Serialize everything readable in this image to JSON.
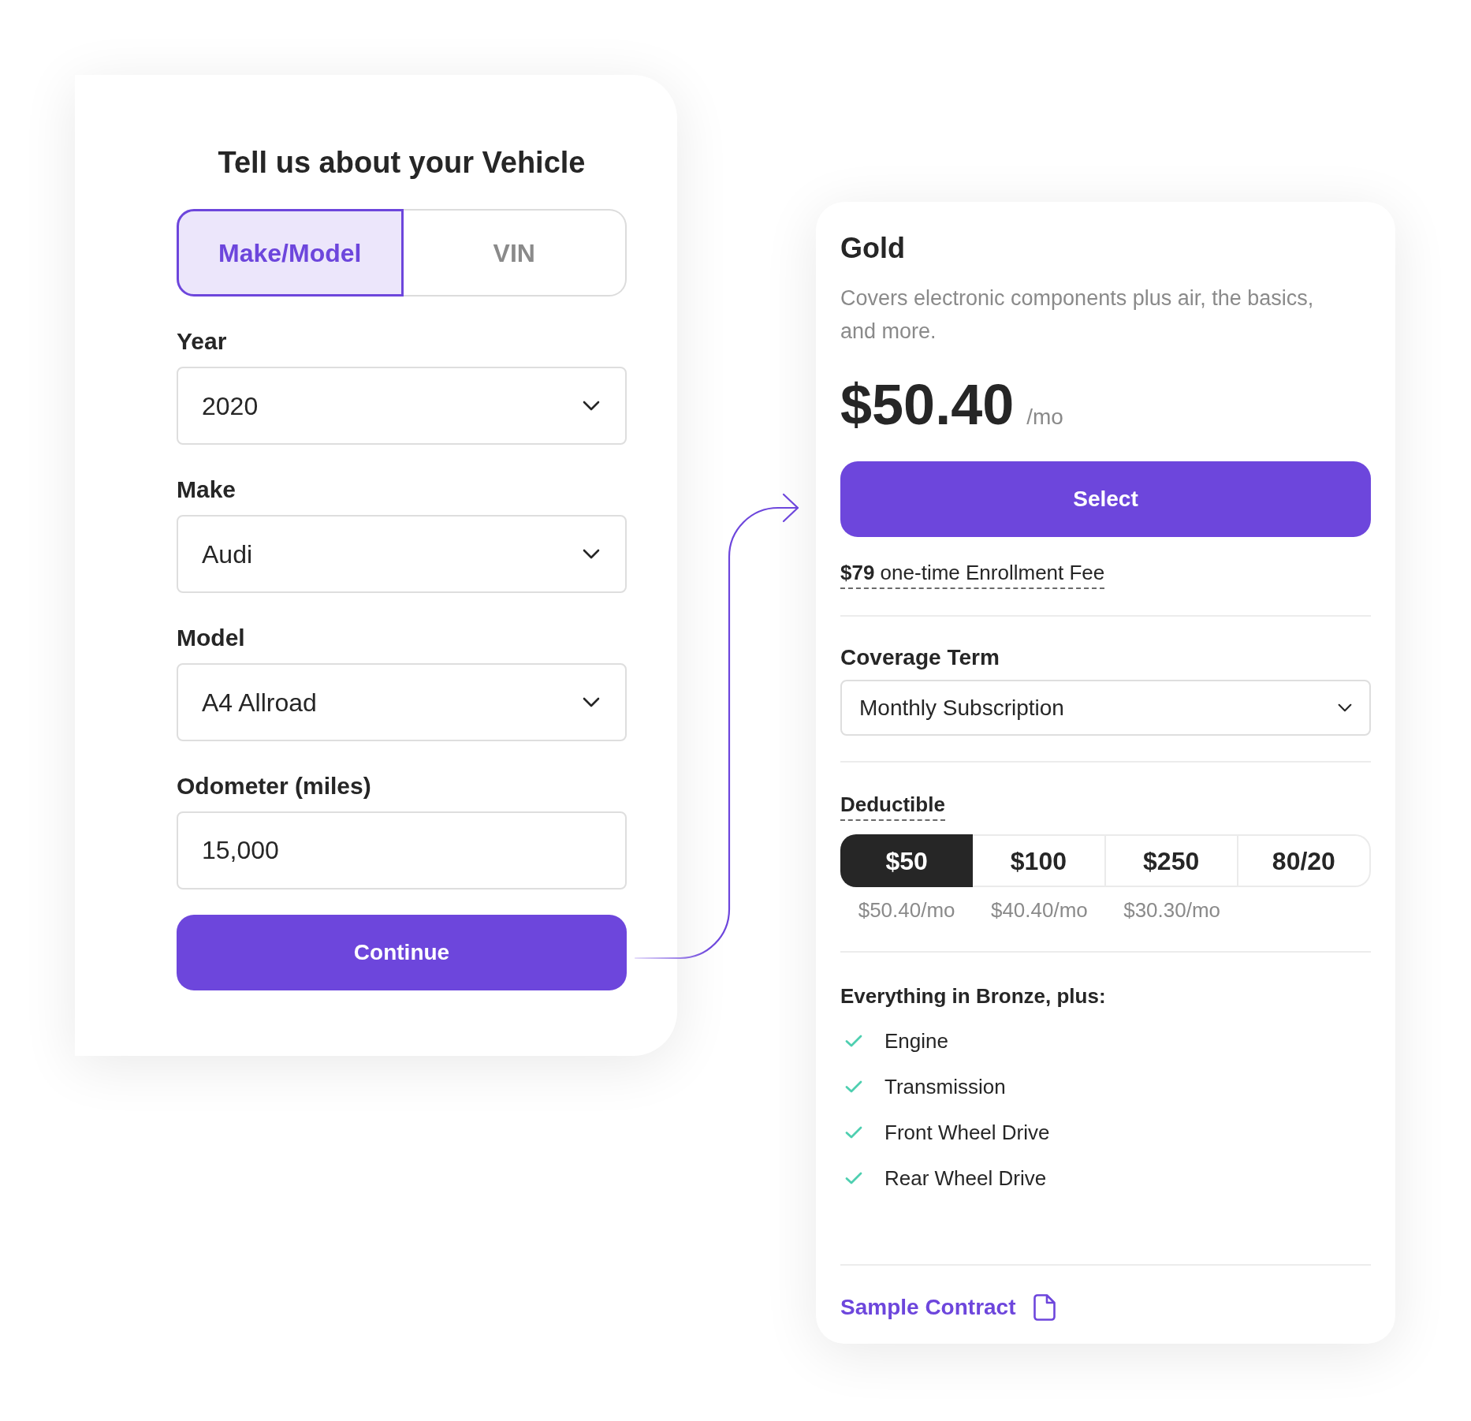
{
  "vehicle_form": {
    "title": "Tell us about your Vehicle",
    "tabs": [
      {
        "label": "Make/Model",
        "selected": true
      },
      {
        "label": "VIN",
        "selected": false
      }
    ],
    "fields": [
      {
        "label": "Year",
        "kind": "select",
        "value": "2020"
      },
      {
        "label": "Make",
        "kind": "select",
        "value": "Audi"
      },
      {
        "label": "Model",
        "kind": "select",
        "value": "A4 Allroad"
      },
      {
        "label": "Odometer (miles)",
        "kind": "text",
        "value": "15,000"
      }
    ],
    "submit_button": "Continue"
  },
  "plan_card": {
    "name": "Gold",
    "description": "Covers electronic components plus air, the basics, and more.",
    "price": "$50.40",
    "price_unit": "/mo",
    "select_button": "Select",
    "enrollment_fee": "**$79** one-time Enrollment Fee",
    "coverage_term": {
      "label": "Coverage Term",
      "value": "Monthly Subscription"
    },
    "deductible": {
      "label": "Deductible",
      "options": [
        {
          "label": "$50",
          "price": "$50.40/mo",
          "selected": true
        },
        {
          "label": "$100",
          "price": "$40.40/mo",
          "selected": false
        },
        {
          "label": "$250",
          "price": "$30.30/mo",
          "selected": false
        },
        {
          "label": "80/20",
          "selected": false
        }
      ]
    },
    "features_heading": "Everything in Bronze, plus:",
    "features": [
      "Engine",
      "Transmission",
      "Front Wheel Drive",
      "Rear Wheel Drive"
    ],
    "sample_contract_link": "Sample Contract"
  }
}
